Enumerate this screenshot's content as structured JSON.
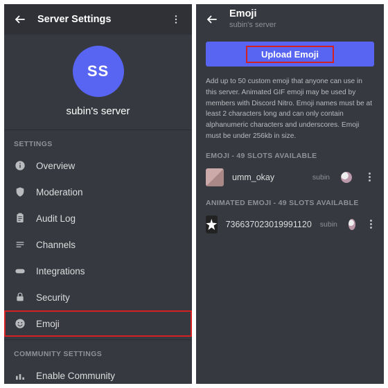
{
  "left": {
    "header_title": "Server Settings",
    "avatar_initials": "SS",
    "server_name": "subin's server",
    "section1": "SETTINGS",
    "items": [
      {
        "label": "Overview"
      },
      {
        "label": "Moderation"
      },
      {
        "label": "Audit Log"
      },
      {
        "label": "Channels"
      },
      {
        "label": "Integrations"
      },
      {
        "label": "Security"
      },
      {
        "label": "Emoji"
      }
    ],
    "section2": "COMMUNITY SETTINGS",
    "community_item": "Enable Community"
  },
  "right": {
    "header_title": "Emoji",
    "header_sub": "subin's server",
    "upload_label": "Upload Emoji",
    "description": "Add up to 50 custom emoji that anyone can use in this server. Animated GIF emoji may be used by members with Discord Nitro. Emoji names must be at least 2 characters long and can only contain alphanumeric characters and underscores. Emoji must be under 256kb in size.",
    "slot_header_static": "EMOJI - 49 SLOTS AVAILABLE",
    "slot_header_animated": "ANIMATED EMOJI - 49 SLOTS AVAILABLE",
    "static_emoji": {
      "name": "umm_okay",
      "uploader": "subin"
    },
    "animated_emoji": {
      "name": "736637023019991120",
      "uploader": "subin"
    }
  }
}
